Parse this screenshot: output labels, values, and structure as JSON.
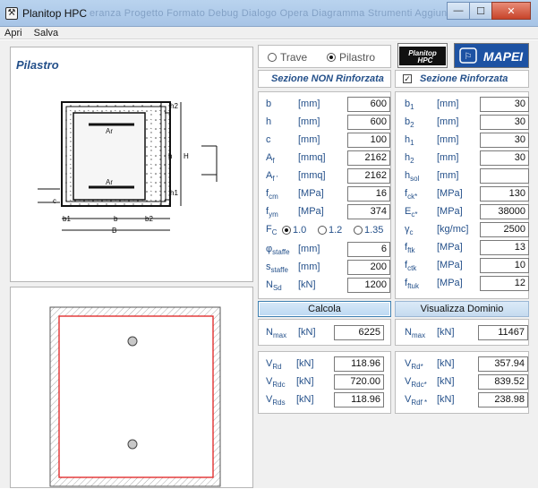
{
  "window": {
    "title": "Planitop HPC",
    "blurred_menu": "eranza  Progetto  Formato  Debug  Dialogo  Opera  Diagramma  Strumenti  Aggiunte  Finestra"
  },
  "menu": [
    "Apri",
    "Salva"
  ],
  "left": {
    "panel_title": "Pilastro",
    "labels": {
      "h2": "h2",
      "h": "h",
      "H": "H",
      "h1": "h1",
      "c": "c",
      "b1": "b1",
      "b": "b",
      "b2": "b2",
      "B": "B",
      "Ar_top": "Ar",
      "Ar_bottom": "Ar"
    }
  },
  "type_select": {
    "options": [
      "Trave",
      "Pilastro"
    ],
    "selected": "Pilastro"
  },
  "logos": {
    "planitop": "Planitop\nHPC",
    "mapei": "MAPEI"
  },
  "section_non": {
    "title": "Sezione NON Rinforzata"
  },
  "section_rinf": {
    "title": "Sezione Rinforzata",
    "checked": true
  },
  "left_params": [
    {
      "sym": "b",
      "sub": "",
      "unit": "[mm]",
      "value": "600"
    },
    {
      "sym": "h",
      "sub": "",
      "unit": "[mm]",
      "value": "600"
    },
    {
      "sym": "c",
      "sub": "",
      "unit": "[mm]",
      "value": "100"
    },
    {
      "sym": "A",
      "sub": "f",
      "unit": "[mmq]",
      "value": "2162"
    },
    {
      "sym": "A",
      "sub": "f '",
      "unit": "[mmq]",
      "value": "2162"
    },
    {
      "sym": "f",
      "sub": "cm",
      "unit": "[MPa]",
      "value": "16"
    },
    {
      "sym": "f",
      "sub": "ym",
      "unit": "[MPa]",
      "value": "374"
    },
    {
      "sym": "φ",
      "sub": "staffe",
      "unit": "[mm]",
      "value": "6"
    },
    {
      "sym": "s",
      "sub": "staffe",
      "unit": "[mm]",
      "value": "200"
    },
    {
      "sym": "N",
      "sub": "Sd",
      "unit": "[kN]",
      "value": "1200"
    }
  ],
  "fc_row": {
    "label": "F",
    "sub": "C",
    "options": [
      "1.0",
      "1.2",
      "1.35"
    ],
    "selected": "1.0"
  },
  "right_params": [
    {
      "sym": "b",
      "sub": "1",
      "unit": "[mm]",
      "value": "30"
    },
    {
      "sym": "b",
      "sub": "2",
      "unit": "[mm]",
      "value": "30"
    },
    {
      "sym": "h",
      "sub": "1",
      "unit": "[mm]",
      "value": "30"
    },
    {
      "sym": "h",
      "sub": "2",
      "unit": "[mm]",
      "value": "30"
    },
    {
      "sym": "h",
      "sub": "sol",
      "unit": "[mm]",
      "value": ""
    },
    {
      "sym": "f",
      "sub": "ck*",
      "unit": "[MPa]",
      "value": "130"
    },
    {
      "sym": "E",
      "sub": "c*",
      "unit": "[MPa]",
      "value": "38000"
    },
    {
      "sym": "γ",
      "sub": "c",
      "unit": "[kg/mc]",
      "value": "2500"
    },
    {
      "sym": "f",
      "sub": "ftk",
      "unit": "[MPa]",
      "value": "13"
    },
    {
      "sym": "f",
      "sub": "ctk",
      "unit": "[MPa]",
      "value": "10"
    },
    {
      "sym": "f",
      "sub": "ftuk",
      "unit": "[MPa]",
      "value": "12"
    }
  ],
  "buttons": {
    "calcola": "Calcola",
    "dominio": "Visualizza Dominio"
  },
  "nmax_left": {
    "sym": "N",
    "sub": "max",
    "unit": "[kN]",
    "value": "6225"
  },
  "nmax_right": {
    "sym": "N",
    "sub": "max",
    "unit": "[kN]",
    "value": "11467"
  },
  "results_left": [
    {
      "sym": "V",
      "sub": "Rd",
      "unit": "[kN]",
      "value": "118.96"
    },
    {
      "sym": "V",
      "sub": "Rdc",
      "unit": "[kN]",
      "value": "720.00"
    },
    {
      "sym": "V",
      "sub": "Rds",
      "unit": "[kN]",
      "value": "118.96"
    }
  ],
  "results_right": [
    {
      "sym": "V",
      "sub": "Rd*",
      "unit": "[kN]",
      "value": "357.94"
    },
    {
      "sym": "V",
      "sub": "Rdc*",
      "unit": "[kN]",
      "value": "839.52"
    },
    {
      "sym": "V",
      "sub": "Rdf *",
      "unit": "[kN]",
      "value": "238.98"
    }
  ],
  "colors": {
    "accent_blue": "#24508a",
    "red_outline": "#e02020",
    "hatch": "#9a9a9a"
  }
}
